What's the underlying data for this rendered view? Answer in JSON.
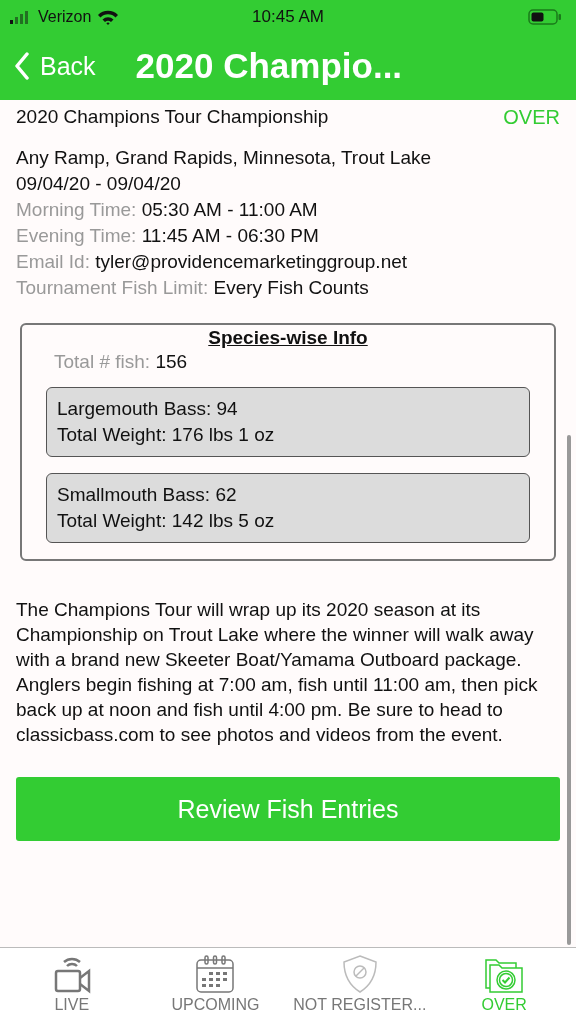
{
  "status_bar": {
    "carrier": "Verizon",
    "time": "10:45 AM"
  },
  "nav": {
    "back": "Back",
    "title": "2020 Champio..."
  },
  "event": {
    "name": "2020 Champions Tour Championship",
    "status": "OVER",
    "location": "Any Ramp, Grand Rapids, Minnesota, Trout Lake",
    "dates": "09/04/20 - 09/04/20",
    "details": [
      {
        "label": "Morning Time:",
        "value": "05:30 AM - 11:00 AM"
      },
      {
        "label": "Evening Time:",
        "value": "11:45 AM - 06:30 PM"
      },
      {
        "label": "Email Id:",
        "value": "tyler@providencemarketinggroup.net"
      },
      {
        "label": "Tournament Fish Limit:",
        "value": "Every Fish Counts"
      }
    ]
  },
  "species_info": {
    "title": "Species-wise Info",
    "total_label": "Total # fish:",
    "total_value": "156",
    "species": [
      {
        "name": "Largemouth Bass: 94",
        "weight": "Total Weight: 176 lbs 1 oz"
      },
      {
        "name": "Smallmouth Bass: 62",
        "weight": "Total Weight: 142 lbs 5 oz"
      }
    ]
  },
  "description": "The Champions Tour will wrap up its 2020 season at its Championship on Trout Lake where the winner will walk away with a brand new Skeeter Boat/Yamama Outboard package. Anglers begin fishing at 7:00 am, fish until 11:00 am, then pick back up at noon and fish until 4:00 pm. Be sure to head to classicbass.com to see photos and videos from the event.",
  "action_button": "Review Fish Entries",
  "tabs": [
    {
      "kind": "live",
      "label": "LIVE",
      "selected": false
    },
    {
      "kind": "upcoming",
      "label": "UPCOMING",
      "selected": false
    },
    {
      "kind": "not_registered",
      "label": "NOT REGISTER...",
      "selected": false
    },
    {
      "kind": "over",
      "label": "OVER",
      "selected": true
    }
  ]
}
